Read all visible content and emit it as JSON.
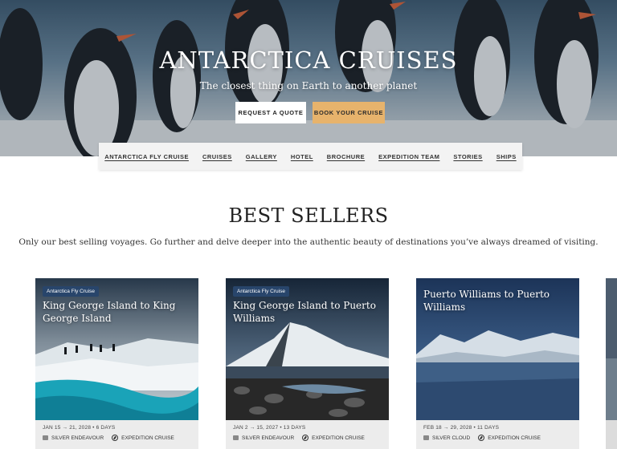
{
  "hero": {
    "title": "ANTARCTICA CRUISES",
    "subtitle": "The closest thing on Earth to another planet",
    "quote_button": "REQUEST A QUOTE",
    "book_button": "BOOK YOUR CRUISE",
    "book_color": "#e7b36c"
  },
  "nav": {
    "items": [
      {
        "label": "ANTARCTICA FLY CRUISE"
      },
      {
        "label": "CRUISES"
      },
      {
        "label": "GALLERY"
      },
      {
        "label": "HOTEL"
      },
      {
        "label": "BROCHURE"
      },
      {
        "label": "EXPEDITION TEAM"
      },
      {
        "label": "STORIES"
      },
      {
        "label": "SHIPS"
      }
    ]
  },
  "best_sellers": {
    "title": "BEST SELLERS",
    "description": "Only our best selling voyages. Go further and delve deeper into the authentic beauty of destinations you’ve always dreamed of visiting."
  },
  "cards": [
    {
      "tag": "Antarctica Fly Cruise",
      "title": "King George Island to King George Island",
      "dates": "JAN 15 → 21, 2028 • 6 DAYS",
      "ship": "SILVER ENDEAVOUR",
      "type": "EXPEDITION CRUISE"
    },
    {
      "tag": "Antarctica Fly Cruise",
      "title": "King George Island to Puerto Williams",
      "dates": "JAN 2 → 15, 2027 • 13 DAYS",
      "ship": "SILVER ENDEAVOUR",
      "type": "EXPEDITION CRUISE"
    },
    {
      "tag": "",
      "title": "Puerto Williams to Puerto Williams",
      "dates": "FEB 18 → 29, 2028 • 11 DAYS",
      "ship": "SILVER CLOUD",
      "type": "EXPEDITION CRUISE"
    }
  ],
  "colors": {
    "tag_bg": "#28456b",
    "card_bg": "#ececec"
  }
}
